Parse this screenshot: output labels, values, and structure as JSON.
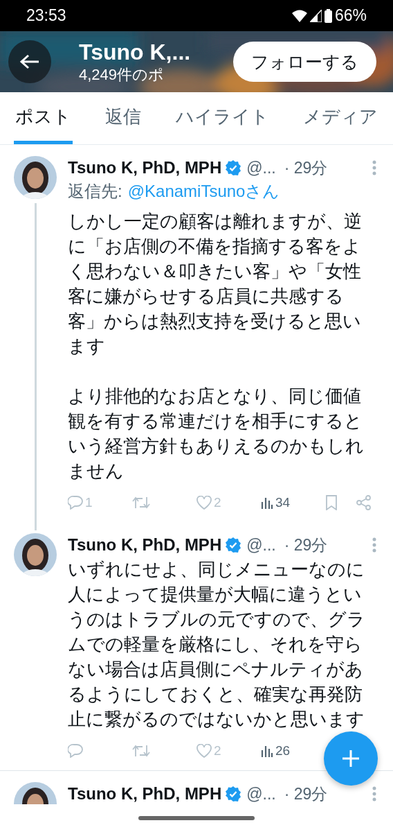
{
  "status_bar": {
    "time": "23:53",
    "battery": "66%"
  },
  "header": {
    "title": "Tsuno K,...",
    "subtitle": "4,249件のポ",
    "follow_button": "フォローする"
  },
  "tabs": [
    {
      "label": "ポスト",
      "selected": true
    },
    {
      "label": "返信",
      "selected": false
    },
    {
      "label": "ハイライト",
      "selected": false
    },
    {
      "label": "メディア",
      "selected": false
    }
  ],
  "posts": [
    {
      "name": "Tsuno K, PhD, MPH",
      "verified": true,
      "handle": "@...",
      "time": "· 29分",
      "reply_to_label": "返信先:",
      "reply_to": "@KanamiTsunoさん",
      "thread_continues": true,
      "body": [
        "しかし一定の顧客は離れますが、逆に「お店側の不備を指摘する客をよく思わない＆叩きたい客」や「女性客に嫌がらせする店員に共感する客」からは熱烈支持を受けると思います",
        "より排他的なお店となり、同じ価値観を有する常連だけを相手にするという経営方針もありえるのかもしれません"
      ],
      "actions": [
        {
          "kind": "reply",
          "count": "1"
        },
        {
          "kind": "repost"
        },
        {
          "kind": "like",
          "count": "2"
        },
        {
          "kind": "views",
          "count": "34"
        },
        {
          "kind": "bookmark"
        },
        {
          "kind": "share"
        }
      ]
    },
    {
      "name": "Tsuno K, PhD, MPH",
      "verified": true,
      "handle": "@...",
      "time": "· 29分",
      "thread_continues": false,
      "body": [
        "いずれにせよ、同じメニューなのに人によって提供量が大幅に違うというのはトラブルの元ですので、グラムでの軽量を厳格にし、それを守らない場合は店員側にペナルティがあるようにしておくと、確実な再発防止に繋がるのではないかと思います"
      ],
      "actions": [
        {
          "kind": "reply"
        },
        {
          "kind": "repost"
        },
        {
          "kind": "like",
          "count": "2"
        },
        {
          "kind": "views",
          "count": "26"
        }
      ]
    },
    {
      "name": "Tsuno K, PhD, MPH",
      "verified": true,
      "handle": "@...",
      "time": "· 29分",
      "thread_continues": false
    }
  ]
}
